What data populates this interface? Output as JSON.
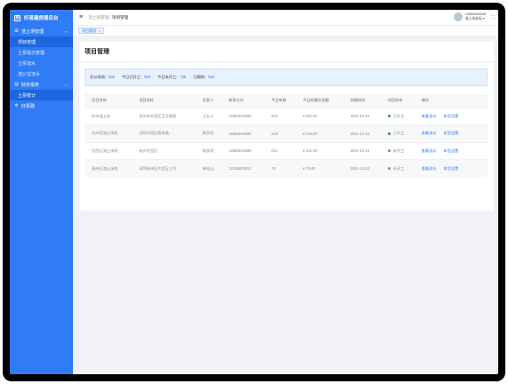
{
  "sidebar": {
    "brand_icon": "园",
    "brand": "好易建房局后台",
    "groups": [
      {
        "label": "渣土场管理",
        "icon": "grid-icon",
        "items": [
          "项目管理",
          "土票批次管理",
          "土票流水",
          "渣公宝流水"
        ]
      },
      {
        "label": "财务报表",
        "icon": "chart-icon",
        "items": [
          "土票统计"
        ]
      },
      {
        "label": "好票融",
        "icon": "gear-icon",
        "items": []
      }
    ]
  },
  "topbar": {
    "breadcrumb_parent": "渣土场管理",
    "breadcrumb_sep": "/",
    "breadcrumb_current": "项目管理",
    "user_phone": "15866666666",
    "user_name": "渣土场老板 ▾"
  },
  "tag": {
    "label": "项目管理",
    "close": "×"
  },
  "page": {
    "title": "项目管理"
  },
  "stats": {
    "total_label": "总计场地：",
    "total": "908",
    "open_label": "今日已开工：",
    "open": "998",
    "closed_label": "今日未开工：",
    "closed": "785",
    "deleted_label": "已删除：",
    "deleted": "552"
  },
  "table": {
    "headers": [
      "项目名称",
      "项目地址",
      "负责人",
      "联系方式",
      "今日车数",
      "今日结算总金额",
      "创建时间",
      "项目状态",
      "操作"
    ],
    "rows": [
      {
        "name": "杭州渣土场",
        "address": "杭州市大西区王开模表",
        "owner": "王志人",
        "phone": "18963910685",
        "cars": "202",
        "amount": "¥ 252.00",
        "created": "2021-12-24",
        "status": "已开工",
        "status_color": "#1f9d55"
      },
      {
        "name": "杭州西渣土场地",
        "address": "深圳大西区朝来路",
        "owner": "陈欣欣",
        "phone": "18963910685",
        "cars": "218",
        "amount": "¥ 218.00",
        "created": "2021-12-24",
        "status": "已开工",
        "status_color": "#1f9d55"
      },
      {
        "name": "大西区渣土场地",
        "address": "杭州大西区",
        "owner": "陈欣欣",
        "phone": "18963910685",
        "cars": "221",
        "amount": "¥ 221.00",
        "created": "2021-12-24",
        "status": "未开工",
        "status_color": "#888888"
      },
      {
        "name": "福州区渣土场地",
        "address": "深圳杭州区大西王三号",
        "owner": "单佳山",
        "phone": "12345678912",
        "cars": "78",
        "amount": "¥ 78.00",
        "created": "2021-12-24",
        "status": "未开工",
        "status_color": "#888888"
      }
    ],
    "actions": [
      "查看流水",
      "车型设置"
    ]
  },
  "colors": {
    "accent": "#2f7cf6",
    "sidebar": "#2f7cf6",
    "active": "#1e66e0"
  }
}
